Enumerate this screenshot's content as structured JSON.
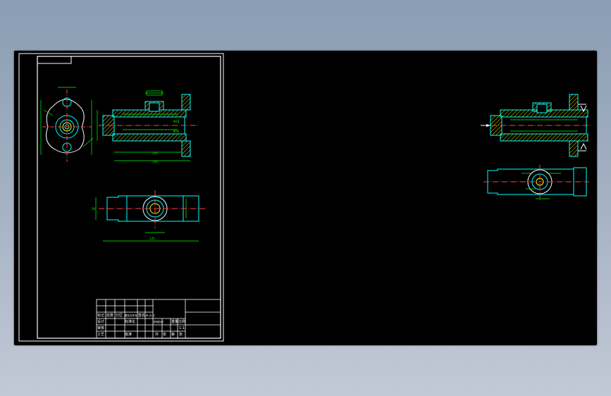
{
  "viewport": {
    "background": "#000000"
  },
  "colors": {
    "frame": "#ffffff",
    "outline": "#00ffff",
    "dimension": "#00ff00",
    "hatch": "#d8d800",
    "centerline": "#ff4040",
    "yellow": "#ffff00"
  },
  "sheet": {
    "title_block": {
      "row1": [
        "标记",
        "处数",
        "分区",
        "更改文件号",
        "签名",
        "年.月.日"
      ],
      "row2": [
        "设计",
        "标准化"
      ],
      "stage_labels": [
        "阶段标记",
        "重量",
        "比例"
      ],
      "scale": "1:1",
      "row_check": "审核",
      "row_process": "工艺",
      "approve": "批准",
      "sheet_info": [
        "共",
        "张",
        "第",
        "张"
      ]
    },
    "dims": {
      "length_total": "135",
      "length_inner": "120",
      "dia_a": "Φ28",
      "dia_b": "Φ20",
      "width": "30"
    }
  }
}
